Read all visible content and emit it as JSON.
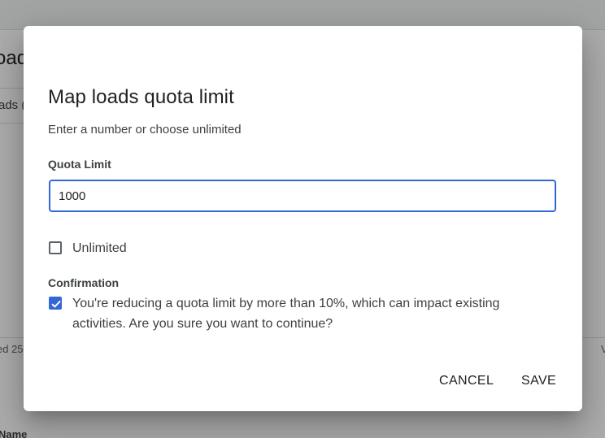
{
  "background": {
    "heading_fragment": "oad",
    "tab_fragment": "ads (",
    "meta_fragment": "ed 25",
    "meta_right_fragment": "V",
    "column_fragment": "Name"
  },
  "dialog": {
    "title": "Map loads quota limit",
    "subtitle": "Enter a number or choose unlimited",
    "quota_label": "Quota Limit",
    "quota_value": "1000",
    "unlimited_label": "Unlimited",
    "unlimited_checked": false,
    "confirmation_label": "Confirmation",
    "confirmation_text": "You're reducing a quota limit by more than 10%, which can impact existing activities. Are you sure you want to continue?",
    "confirmation_checked": true,
    "cancel_label": "CANCEL",
    "save_label": "SAVE"
  },
  "colors": {
    "accent": "#3367d6",
    "text": "#3c4043",
    "scrim": "rgba(0,0,0,0.32)"
  },
  "icons": {
    "checkmark": "check-icon"
  }
}
